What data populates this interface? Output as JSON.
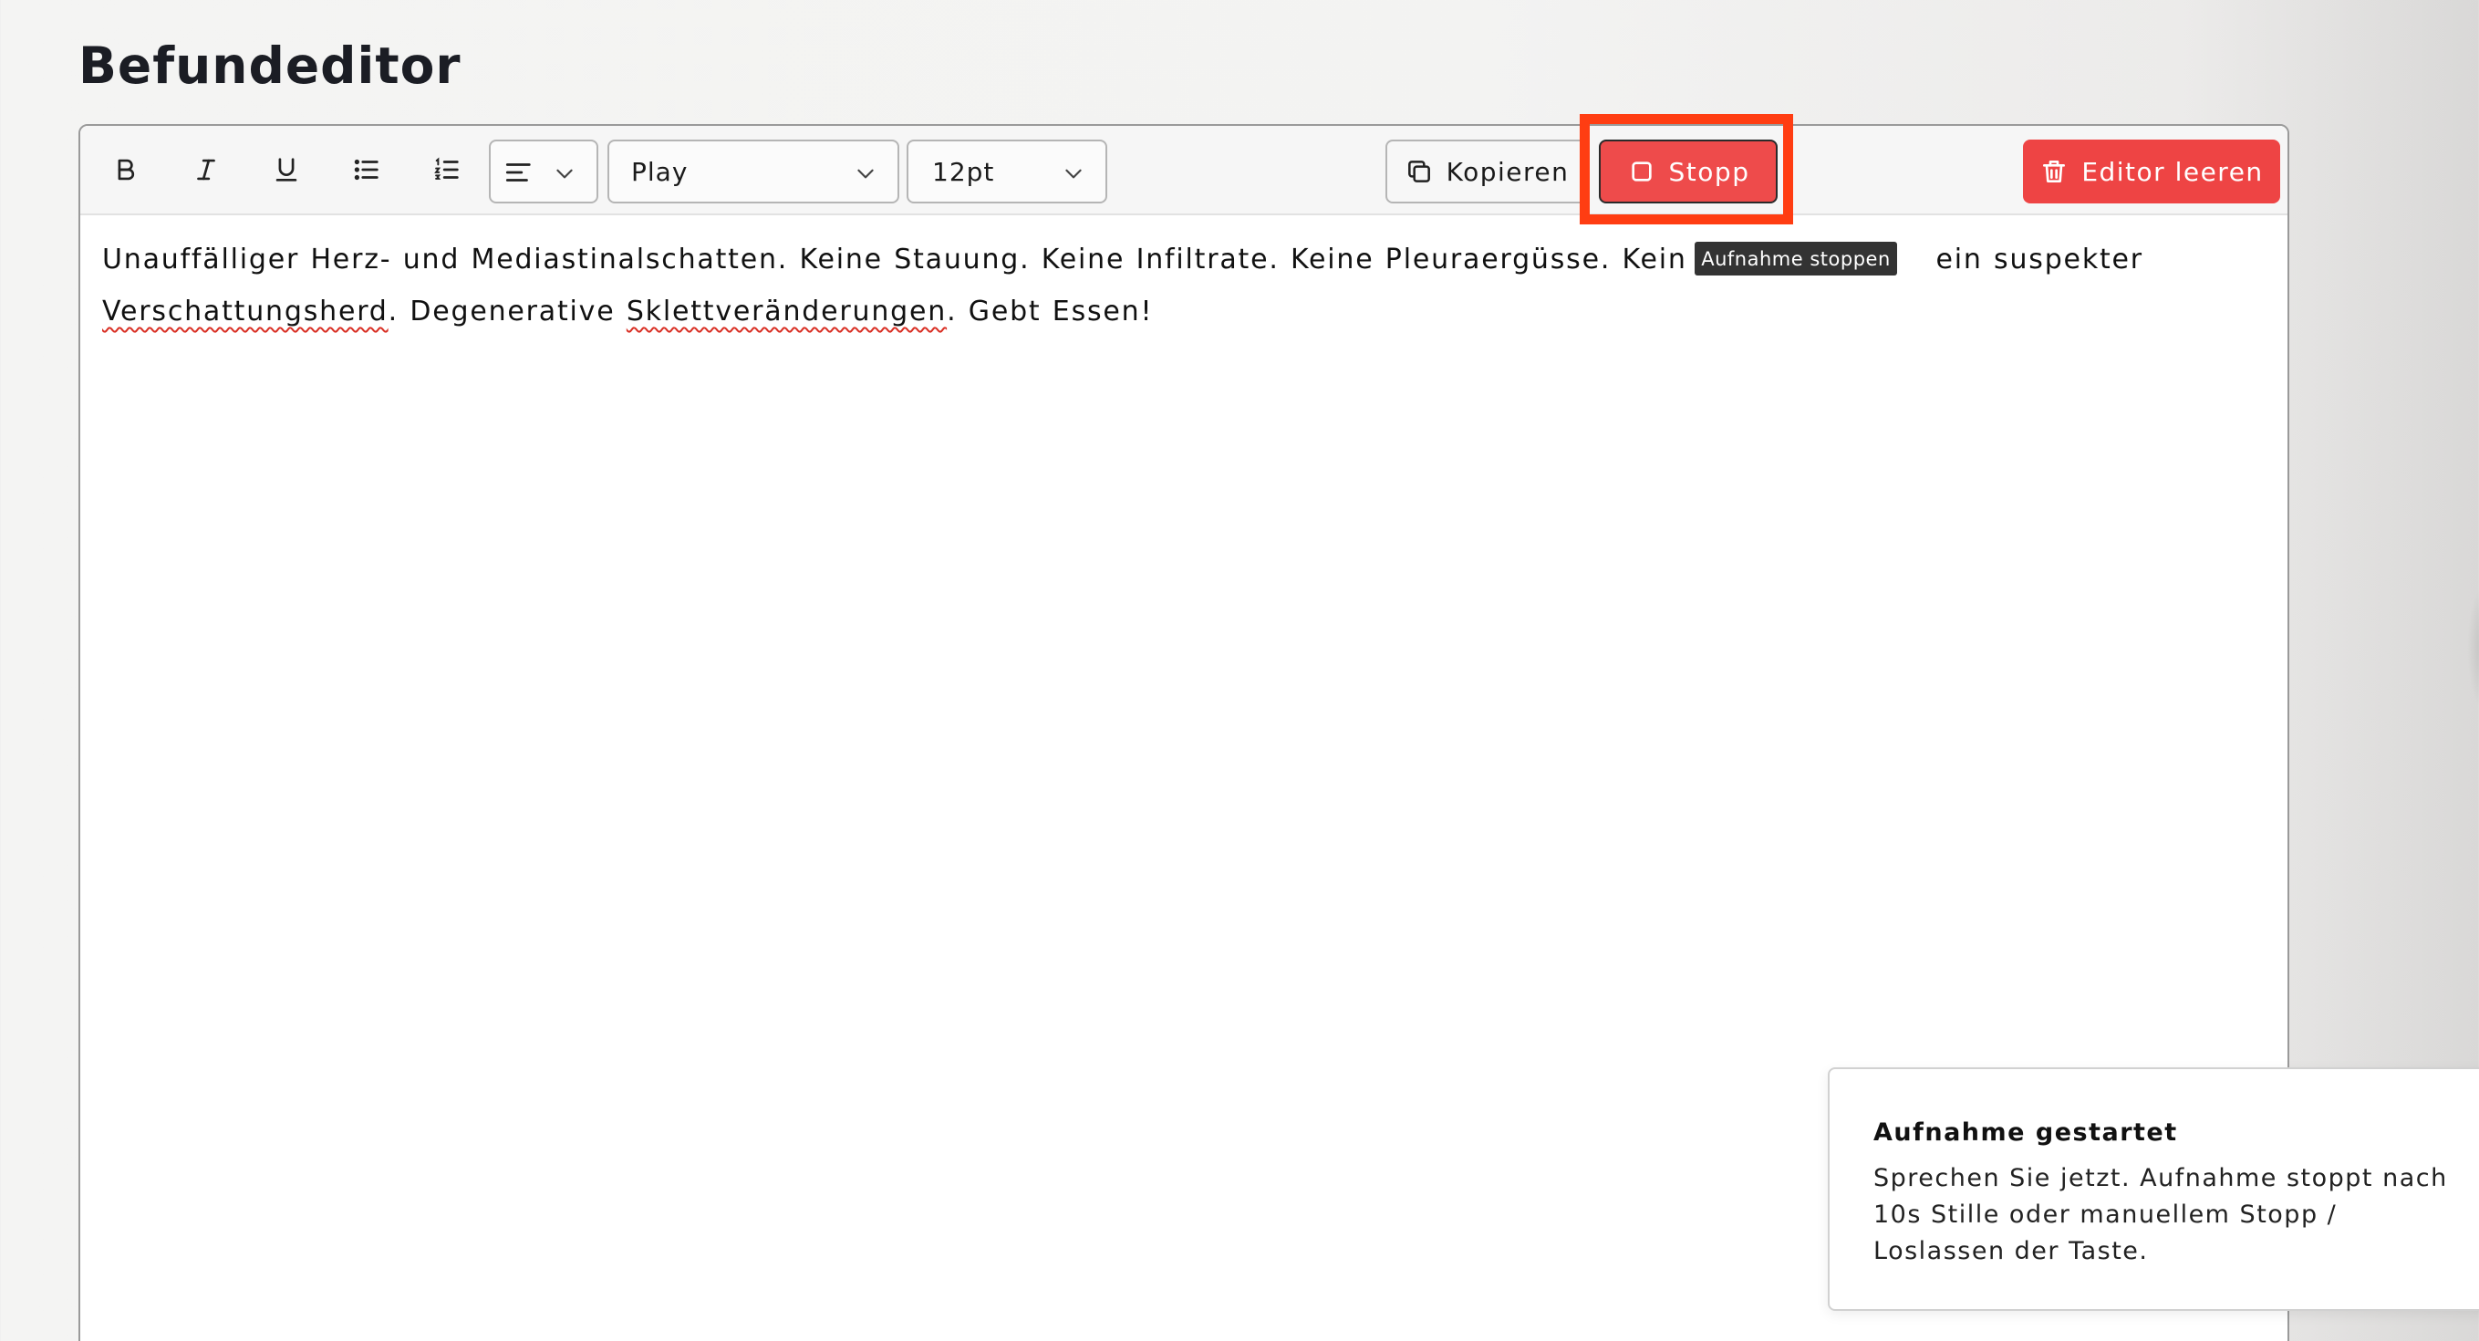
{
  "page": {
    "title": "Befundeditor"
  },
  "toolbar": {
    "format_buttons": [
      {
        "name": "bold",
        "icon": "bold-icon"
      },
      {
        "name": "italic",
        "icon": "italic-icon"
      },
      {
        "name": "underline",
        "icon": "underline-icon"
      },
      {
        "name": "bullet-list",
        "icon": "bullet-list-icon"
      },
      {
        "name": "numbered-list",
        "icon": "numbered-list-icon"
      }
    ],
    "align_select": {
      "icon": "align-left-icon"
    },
    "font_select": {
      "value": "Play"
    },
    "size_select": {
      "value": "12pt"
    },
    "copy_label": "Kopieren",
    "stop_label": "Stopp",
    "clear_label": "Editor leeren",
    "stop_tooltip": "Aufnahme stoppen"
  },
  "editor": {
    "seg1": "Unauffälliger Herz- und Mediastinalschatten. Keine Stauung. Keine Infiltrate. Keine Pleuraergüsse. Kein Pne",
    "seg2": "ein suspekter",
    "spell1": "Verschattungsherd",
    "seg3": ". Degenerative ",
    "spell2": "Sklettveränderungen",
    "seg4": ". Gebt Essen!"
  },
  "toast": {
    "title": "Aufnahme gestartet",
    "message": "Sprechen Sie jetzt. Aufnahme stoppt nach 10s Stille oder manuellem Stopp / Loslassen der Taste."
  },
  "colors": {
    "stop_button": "#ee4b4b",
    "clear_button": "#ee4444",
    "highlight_frame": "#ff3d12",
    "tooltip_bg": "#333333"
  }
}
